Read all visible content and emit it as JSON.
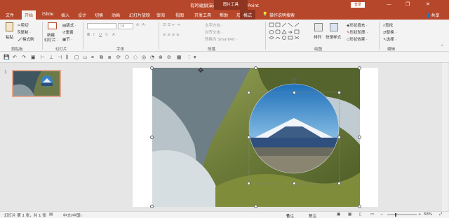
{
  "titlebar": {
    "filename": "有吟磁屏演示.pptx",
    "separator": " - ",
    "app": "PowerPoint",
    "context_tab": "图片工具",
    "login": "登录",
    "minimize": "—",
    "restore": "❐",
    "close": "✕"
  },
  "tabs": {
    "file": "文件",
    "home": "开始",
    "islide": "iSlide",
    "insert": "插入",
    "design": "设计",
    "transitions": "切换",
    "animations": "动画",
    "slideshow": "幻灯片放映",
    "review": "审阅",
    "view": "视图",
    "developer": "开发工具",
    "help": "帮助",
    "shapeproc": "形状处理",
    "format": "格式",
    "tellme": "操作说明搜索",
    "share": "共享"
  },
  "ribbon": {
    "clipboard": {
      "paste": "粘贴",
      "cut": "剪切",
      "copy": "复制 ·",
      "format_painter": "格式刷",
      "group": "剪贴板"
    },
    "slides": {
      "new_slide": "新建",
      "new_slide2": "幻灯片 ·",
      "layout": "版式 ·",
      "reset": "重置",
      "section": "节 ·",
      "group": "幻灯片"
    },
    "font": {
      "font_size": "18",
      "bold": "B",
      "italic": "I",
      "underline": "U",
      "strike": "S",
      "group": "字体"
    },
    "paragraph": {
      "text_direction": "文字方向 ·",
      "align_text": "对齐文本 ·",
      "smartart": "转换为 SmartArt ·",
      "group": "段落"
    },
    "drawing": {
      "arrange": "排列",
      "quick_styles": "快速样式",
      "fill": "形状填充 ·",
      "outline": "形状轮廓 ·",
      "effects": "形状效果 ·",
      "group": "绘图"
    },
    "editing": {
      "find": "查找",
      "replace": "替换 ·",
      "select": "选择 ·",
      "group": "编辑"
    }
  },
  "thumbnail": {
    "number": "1"
  },
  "statusbar": {
    "slide_info": "幻灯片 第 1 张，共 1 张",
    "language": "中文(中国)",
    "notes": "备注",
    "comments": "批注",
    "zoom": "58%"
  }
}
